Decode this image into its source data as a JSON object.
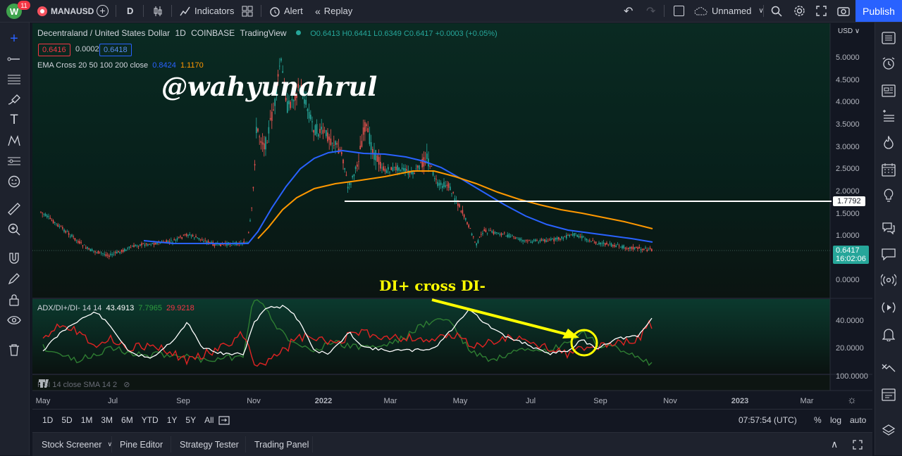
{
  "topbar": {
    "avatar_letter": "W",
    "notifications": "11",
    "symbol": "MANAUSD",
    "interval": "D",
    "indicators": "Indicators",
    "alert": "Alert",
    "replay": "Replay",
    "layout_name": "Unnamed",
    "publish": "Publish"
  },
  "legend": {
    "title": "Decentraland / United States Dollar",
    "interval": "1D",
    "exchange": "COINBASE",
    "source": "TradingView",
    "ohlc": "O0.6413 H0.6441 L0.6349 C0.6417 +0.0003 (+0.05%)",
    "bid": "0.6416",
    "spread": "0.0002",
    "ask": "0.6418",
    "ema_label": "EMA Cross 20 50 100 200 close",
    "ema_val1": "0.8424",
    "ema_val2": "1.1170",
    "adx_label": "ADX/DI+/DI- 14 14",
    "adx_val": "43.4913",
    "di_plus_val": "7.7965",
    "di_minus_val": "29.9218",
    "rsi_label": "RSI 14 close SMA 14 2"
  },
  "price_axis": {
    "currency": "USD",
    "ticks": [
      "5.0000",
      "4.5000",
      "4.0000",
      "3.5000",
      "3.0000",
      "2.5000",
      "2.0000",
      "1.5000",
      "1.0000",
      "0.0000"
    ],
    "hline_label": "1.7792",
    "last_price": "0.6417",
    "countdown": "16:02:06"
  },
  "adx_axis": {
    "ticks": [
      "40.0000",
      "20.0000"
    ],
    "rsi_tick": "100.0000"
  },
  "time_axis": [
    "May",
    "Jul",
    "Sep",
    "Nov",
    "2022",
    "Mar",
    "May",
    "Jul",
    "Sep",
    "Nov",
    "2023",
    "Mar"
  ],
  "annotations": {
    "watermark": "@wahyunahrul",
    "cross_label": "DI+ cross DI-"
  },
  "ranges": [
    "1D",
    "5D",
    "1M",
    "3M",
    "6M",
    "YTD",
    "1Y",
    "5Y",
    "All"
  ],
  "bottom_right": {
    "clock": "07:57:54 (UTC)",
    "percent": "%",
    "log": "log",
    "auto": "auto"
  },
  "panels": [
    "Stock Screener",
    "Pine Editor",
    "Strategy Tester",
    "Trading Panel"
  ],
  "colors": {
    "ema_fast": "#2962ff",
    "ema_slow": "#ff9800",
    "adx": "#ffffff",
    "di_plus": "#2e7d32",
    "di_minus": "#f23645",
    "last_price": "#26a69a",
    "annotation": "#ffff00"
  }
}
